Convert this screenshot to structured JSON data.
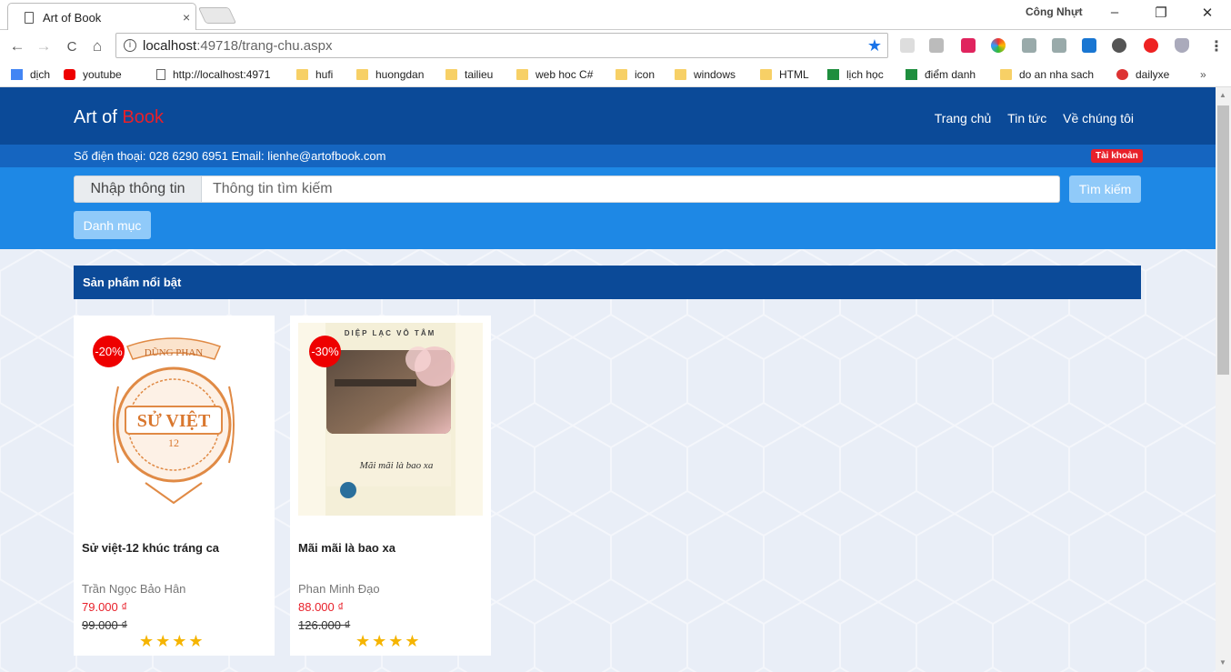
{
  "browser": {
    "tab_title": "Art of Book",
    "tab_close": "×",
    "profile_name": "Công Nhựt",
    "url_host": "localhost",
    "url_path": ":49718/trang-chu.aspx",
    "minimize": "–",
    "restore": "❐",
    "close": "✕",
    "back": "←",
    "forward": "→",
    "reload": "C",
    "home": "⌂",
    "menu": "⋮",
    "bookmarks": [
      {
        "label": "dịch",
        "icon": "google-translate-icon"
      },
      {
        "label": "youtube",
        "icon": "youtube-icon"
      },
      {
        "label": "http://localhost:4971",
        "icon": "page-icon"
      },
      {
        "label": "hufi",
        "icon": "folder-icon"
      },
      {
        "label": "huongdan",
        "icon": "folder-icon"
      },
      {
        "label": "tailieu",
        "icon": "folder-icon"
      },
      {
        "label": "web hoc C#",
        "icon": "folder-icon"
      },
      {
        "label": "icon",
        "icon": "folder-icon"
      },
      {
        "label": "windows",
        "icon": "folder-icon"
      },
      {
        "label": "HTML",
        "icon": "folder-icon"
      },
      {
        "label": "lịch học",
        "icon": "sheets-icon"
      },
      {
        "label": "điểm danh",
        "icon": "sheets-icon"
      },
      {
        "label": "do an nha sach",
        "icon": "folder-icon"
      },
      {
        "label": "dailyxe",
        "icon": "dailyxe-icon"
      }
    ],
    "more_bookmarks": "»"
  },
  "site": {
    "brand_prefix": "Art of ",
    "brand_accent": "Book",
    "nav": [
      "Trang chủ",
      "Tin tức",
      "Về chúng tôi"
    ],
    "contact": "Số điện thoại: 028 6290 6951 Email: lienhe@artofbook.com",
    "account_label": "Tài khoản",
    "search": {
      "label": "Nhập thông tin",
      "placeholder": "Thông tin tìm kiếm",
      "button": "Tìm kiếm"
    },
    "category_button": "Danh mục",
    "section_title": "Sản phẩm nổi bật",
    "colors": {
      "header": "#0b4a98",
      "contact_bar": "#1565c0",
      "search_bar": "#1e88e5",
      "accent_red": "#e8202a",
      "star": "#f5b400"
    }
  },
  "products": [
    {
      "discount": "-20%",
      "title": "Sử việt-12 khúc tráng ca",
      "author": "Trần Ngọc Bảo Hân",
      "price": "79.000 ₫",
      "old_price": "99.000 ₫",
      "stars": "★★★★",
      "rating": 4,
      "cover_text": [
        "DŨNG PHAN",
        "SỬ VIỆT",
        "12"
      ]
    },
    {
      "discount": "-30%",
      "title": "Mãi mãi là bao xa",
      "author": "Phan Minh Đạo",
      "price": "88.000 ₫",
      "old_price": "126.000 ₫",
      "stars": "★★★★",
      "rating": 4,
      "cover_text": [
        "DIỆP LẠC VÔ TÂM",
        "Mãi mãi là bao xa"
      ]
    }
  ]
}
